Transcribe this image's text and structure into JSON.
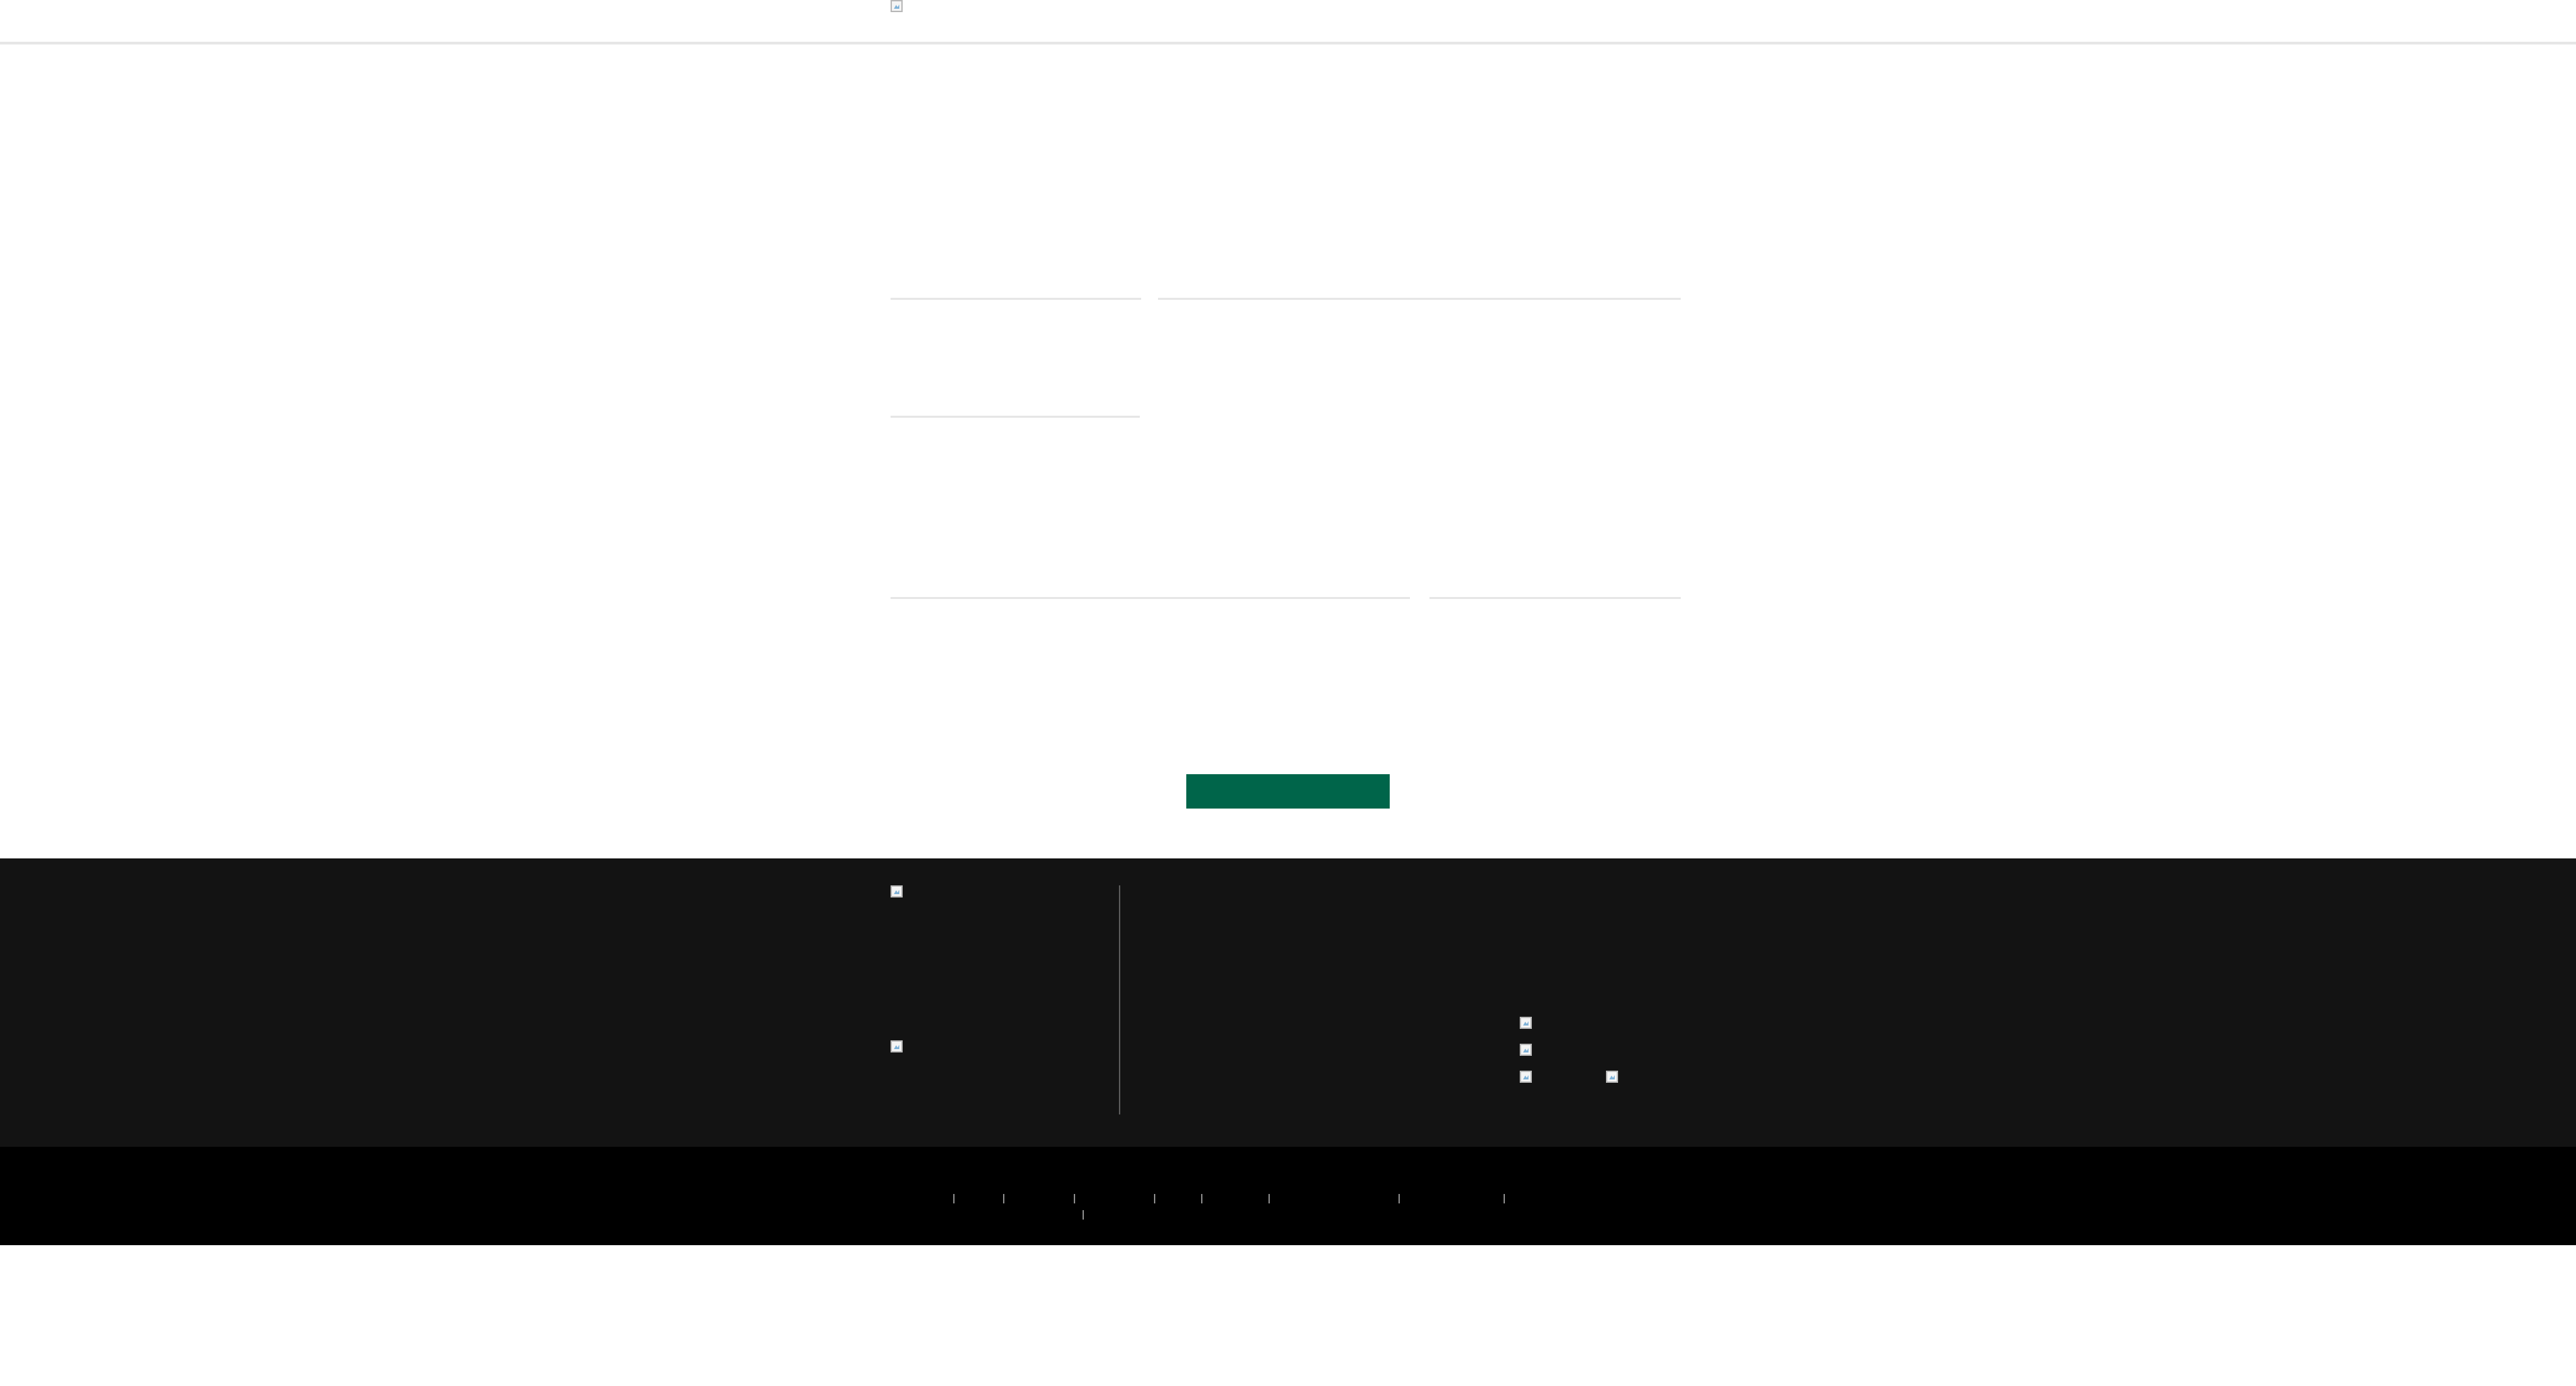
{
  "header": {
    "logo": {
      "icon": "broken-image-icon"
    }
  },
  "form": {
    "fields": [
      {
        "id": "first-name",
        "value": "",
        "placeholder": ""
      },
      {
        "id": "last-name",
        "value": "",
        "placeholder": ""
      },
      {
        "id": "zip",
        "value": "",
        "placeholder": ""
      },
      {
        "id": "email",
        "value": "",
        "placeholder": ""
      },
      {
        "id": "phone",
        "value": "",
        "placeholder": ""
      }
    ],
    "submit_label": ""
  },
  "footer": {
    "logos": [
      {
        "icon": "broken-image-icon"
      },
      {
        "icon": "broken-image-icon"
      }
    ],
    "app_badges": [
      {
        "icon": "broken-image-icon"
      },
      {
        "icon": "broken-image-icon"
      },
      {
        "icon": "broken-image-icon"
      },
      {
        "icon": "broken-image-icon"
      }
    ],
    "legal_links_count": 9
  },
  "colors": {
    "accent": "#00654a",
    "footer_bg": "#131313",
    "legal_bg": "#000000",
    "field_line": "#e6e6e6",
    "divider": "#5a5a5a"
  }
}
